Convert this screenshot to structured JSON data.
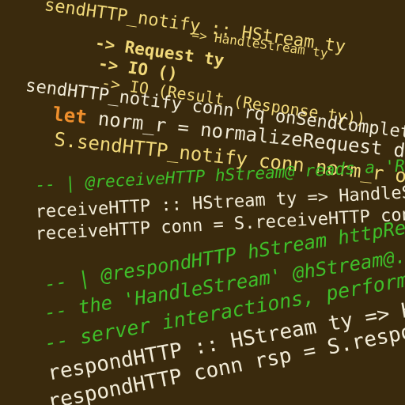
{
  "code": {
    "line1": "sendHTTP_notify :: HStream ty",
    "line2": "=> HandleStream ty",
    "line3": "-> Request ty",
    "line4": "-> IO ()",
    "line5": "-> IO (Result (Response ty))",
    "line6": "sendHTTP_notify conn rq onSendComplete = do",
    "line7_kw": "let",
    "line7": "norm_r = normalizeRequest defaultNormalizeRequestOptions rq",
    "line8": "S.sendHTTP_notify conn norm_r onSendComplete",
    "line9": "-- | @receiveHTTP hStream@ reads a 'Request' from the",
    "line10": "receiveHTTP :: HStream ty => HandleStream ty ->",
    "line11": "receiveHTTP conn = S.receiveHTTP conn",
    "line12": "-- | @respondHTTP hStream httpResponse@ transmits",
    "line13": "-- the 'HandleStream' @hStream@. It could be used",
    "line14": "-- server interactions, performing the dual role",
    "line15": "respondHTTP :: HStream ty => HandleStream ty ->",
    "line16": "respondHTTP conn rsp = S.respondHTTP conn rsp"
  }
}
